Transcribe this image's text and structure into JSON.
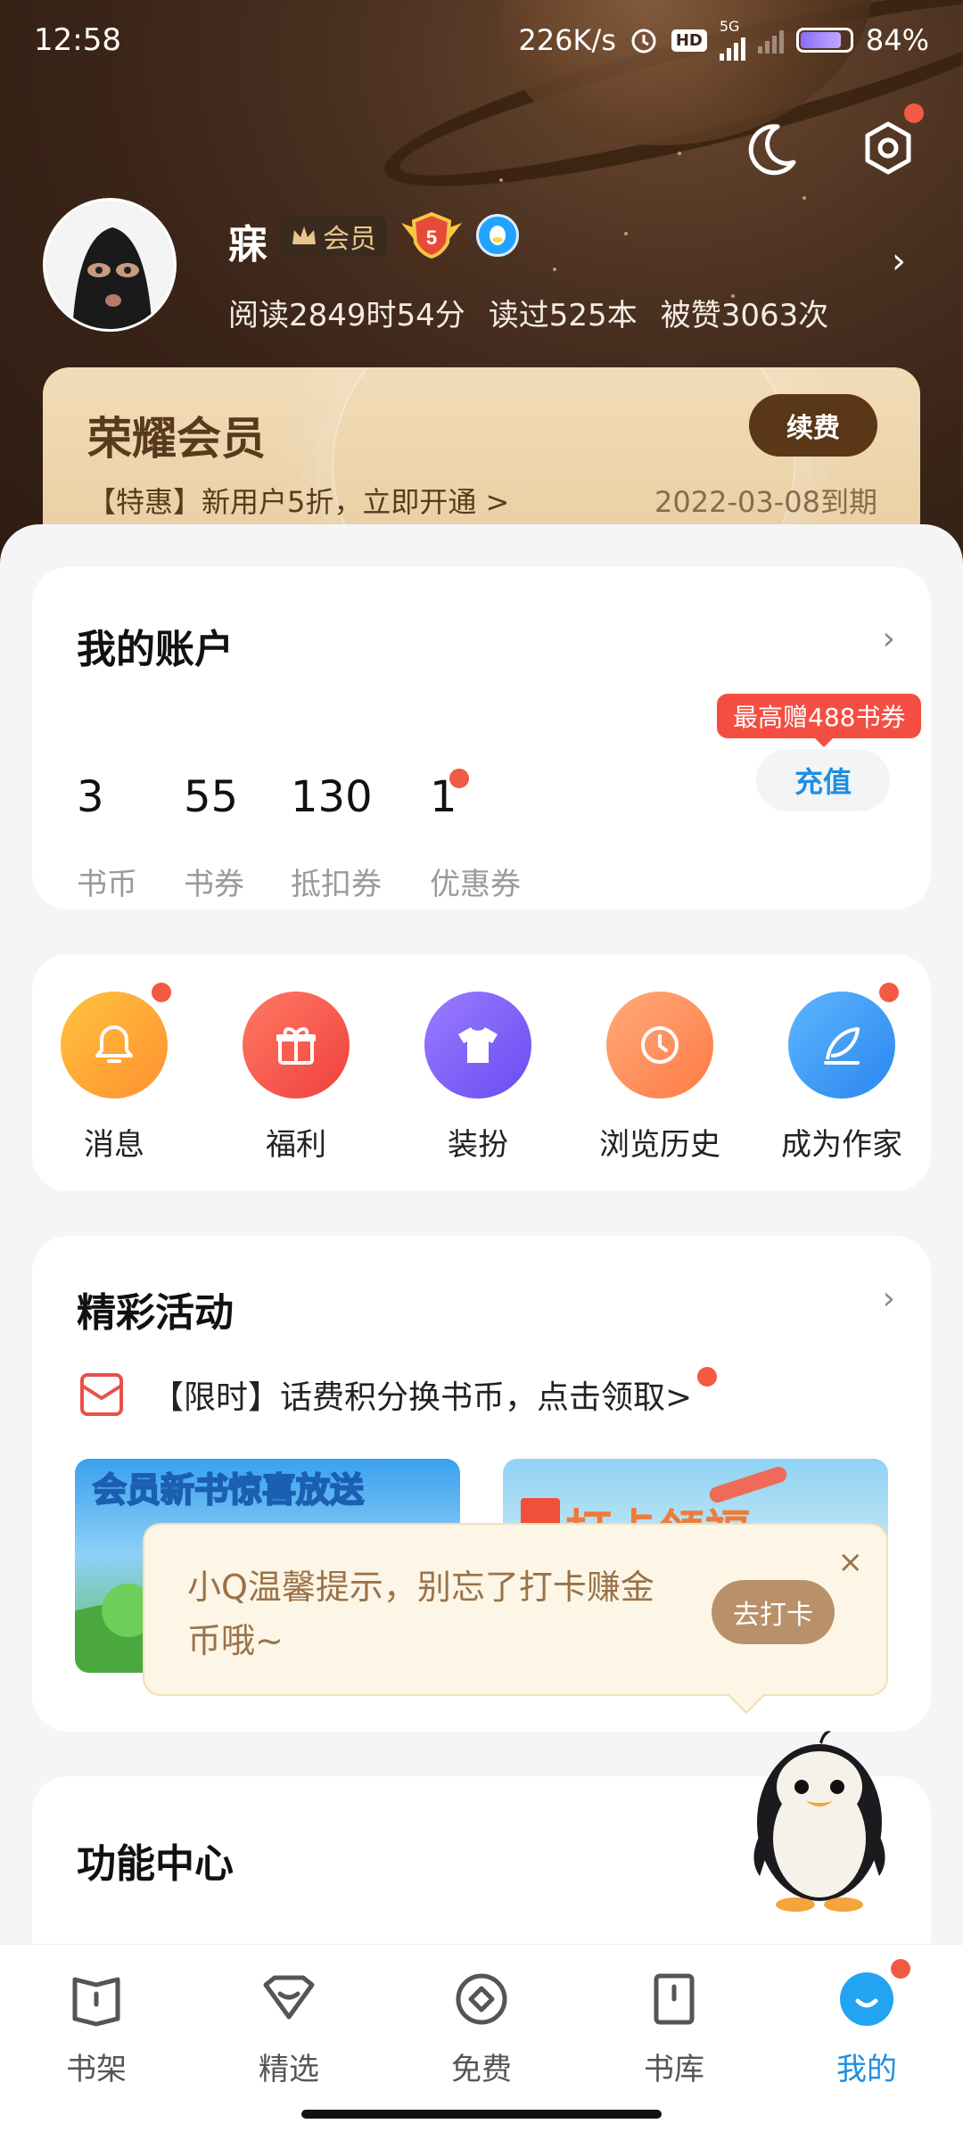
{
  "status_bar": {
    "time": "12:58",
    "net_speed": "226K/s",
    "hd": "HD",
    "network": "5G",
    "battery": "84%",
    "battery_level": 0.84
  },
  "profile": {
    "username": "寐",
    "vip_label": "会员",
    "level": "5",
    "stats": {
      "read_time": "阅读2849时54分",
      "books_read": "读过525本",
      "likes": "被赞3063次"
    }
  },
  "member_card": {
    "title": "荣耀会员",
    "renew_label": "续费",
    "promo": "【特惠】新用户5折，立即开通 >",
    "expire": "2022-03-08到期"
  },
  "account": {
    "title": "我的账户",
    "items": [
      {
        "value": "3",
        "label": "书币"
      },
      {
        "value": "55",
        "label": "书券"
      },
      {
        "value": "130",
        "label": "抵扣券"
      },
      {
        "value": "1",
        "label": "优惠券"
      }
    ],
    "bubble": "最高赠488书券",
    "recharge_label": "充值"
  },
  "tools": [
    {
      "label": "消息",
      "icon": "bell-icon",
      "color": "#ffa538"
    },
    {
      "label": "福利",
      "icon": "gift-icon",
      "color": "#f5614f"
    },
    {
      "label": "装扮",
      "icon": "shirt-icon",
      "color": "#7c5cf6"
    },
    {
      "label": "浏览历史",
      "icon": "clock-icon",
      "color": "#ff8f5a"
    },
    {
      "label": "成为作家",
      "icon": "feather-pen-icon",
      "color": "#3a95f5"
    }
  ],
  "activities": {
    "title": "精彩活动",
    "promo_line": "【限时】话费积分换书币，点击领取>",
    "banners": [
      {
        "title": "会员新书惊喜放送"
      },
      {
        "title": "打卡领福"
      }
    ]
  },
  "tip": {
    "text": "小Q温馨提示，别忘了打卡赚金币哦~",
    "button": "去打卡",
    "close": "×"
  },
  "functions": {
    "title": "功能中心"
  },
  "bottom_nav": [
    {
      "label": "书架",
      "icon": "bookshelf-icon",
      "active": false
    },
    {
      "label": "精选",
      "icon": "featured-icon",
      "active": false
    },
    {
      "label": "免费",
      "icon": "free-icon",
      "active": false
    },
    {
      "label": "书库",
      "icon": "library-icon",
      "active": false
    },
    {
      "label": "我的",
      "icon": "profile-icon",
      "active": true
    }
  ],
  "colors": {
    "accent_blue": "#1e8fe0",
    "alert_red": "#f44e42",
    "member_brown": "#5a3716"
  }
}
